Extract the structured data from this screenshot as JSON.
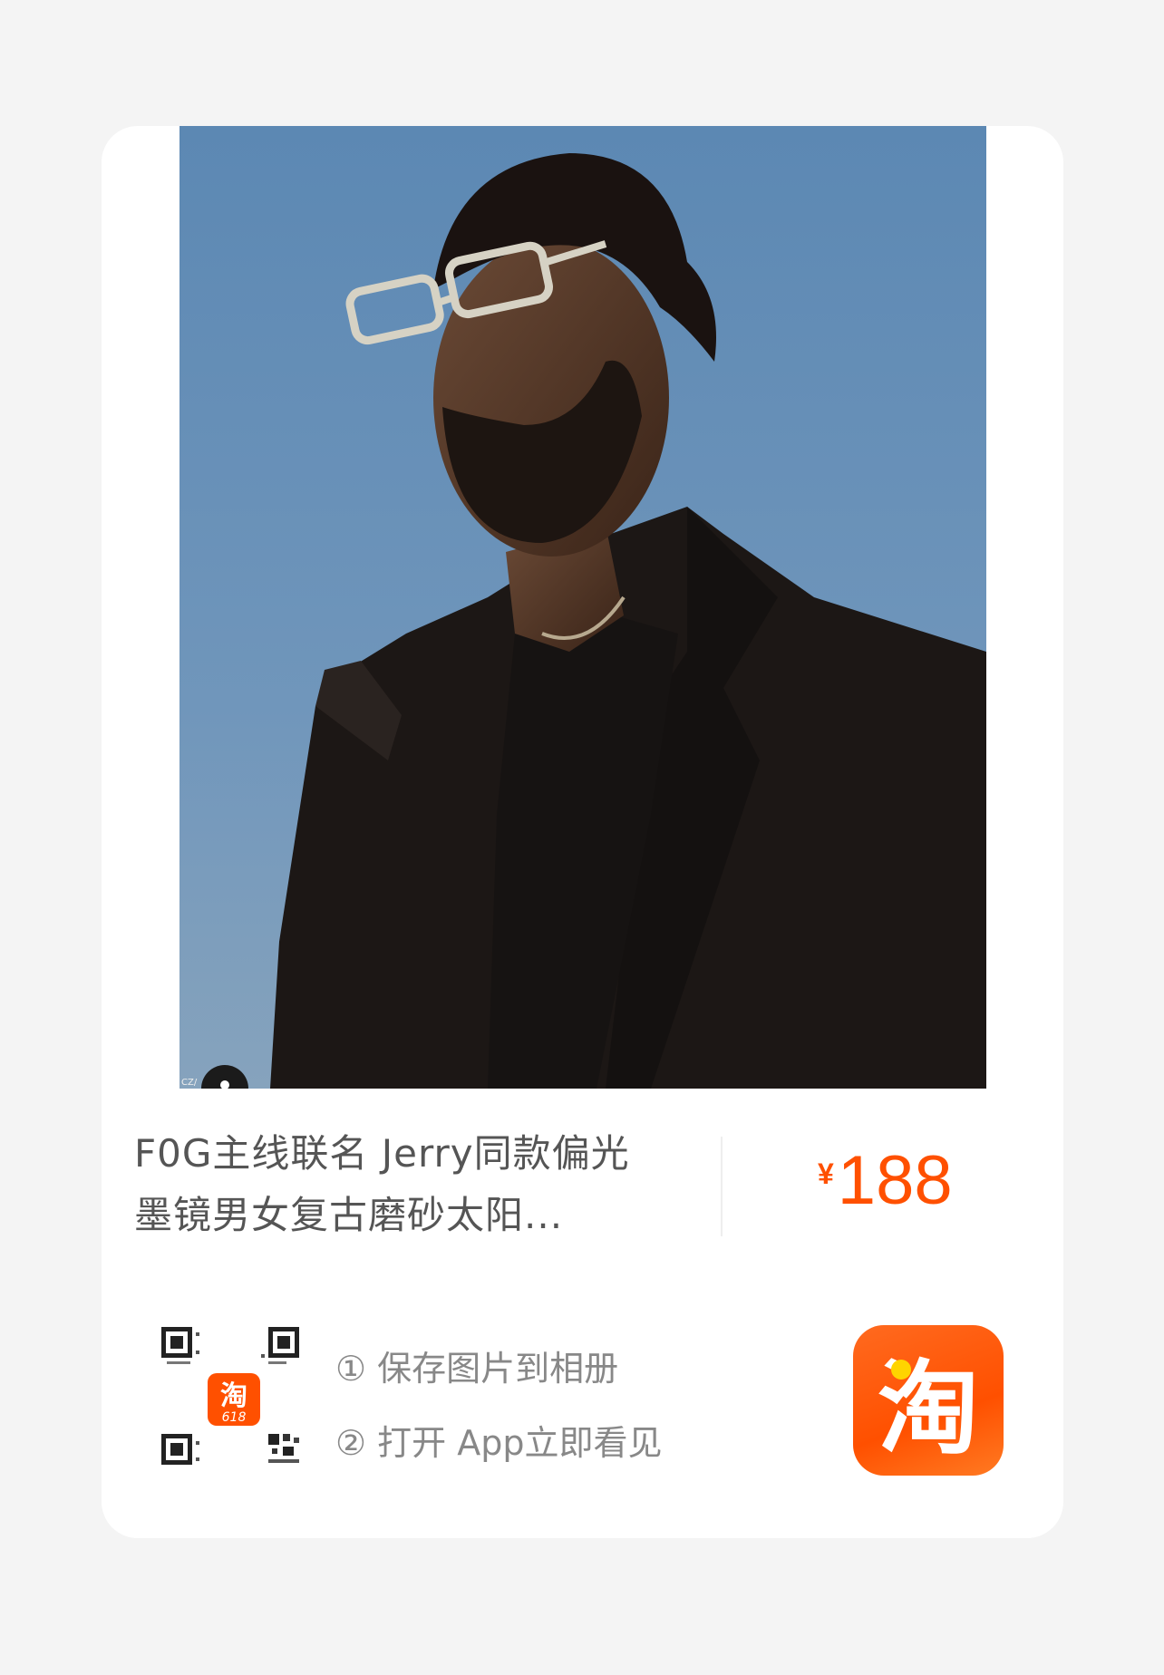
{
  "product": {
    "title": "F0G主线联名 Jerry同款偏光墨镜男女复古磨砂太阳...",
    "currency": "¥",
    "price": "188",
    "price_color": "#ff5000"
  },
  "photo": {
    "watermark": "CZ/"
  },
  "share": {
    "qr_badge": "淘",
    "qr_badge_sub": "618",
    "step1": "① 保存图片到相册",
    "step2": "② 打开 App立即看见"
  },
  "app_icon": {
    "glyph": "淘",
    "color": "#ff5000"
  }
}
